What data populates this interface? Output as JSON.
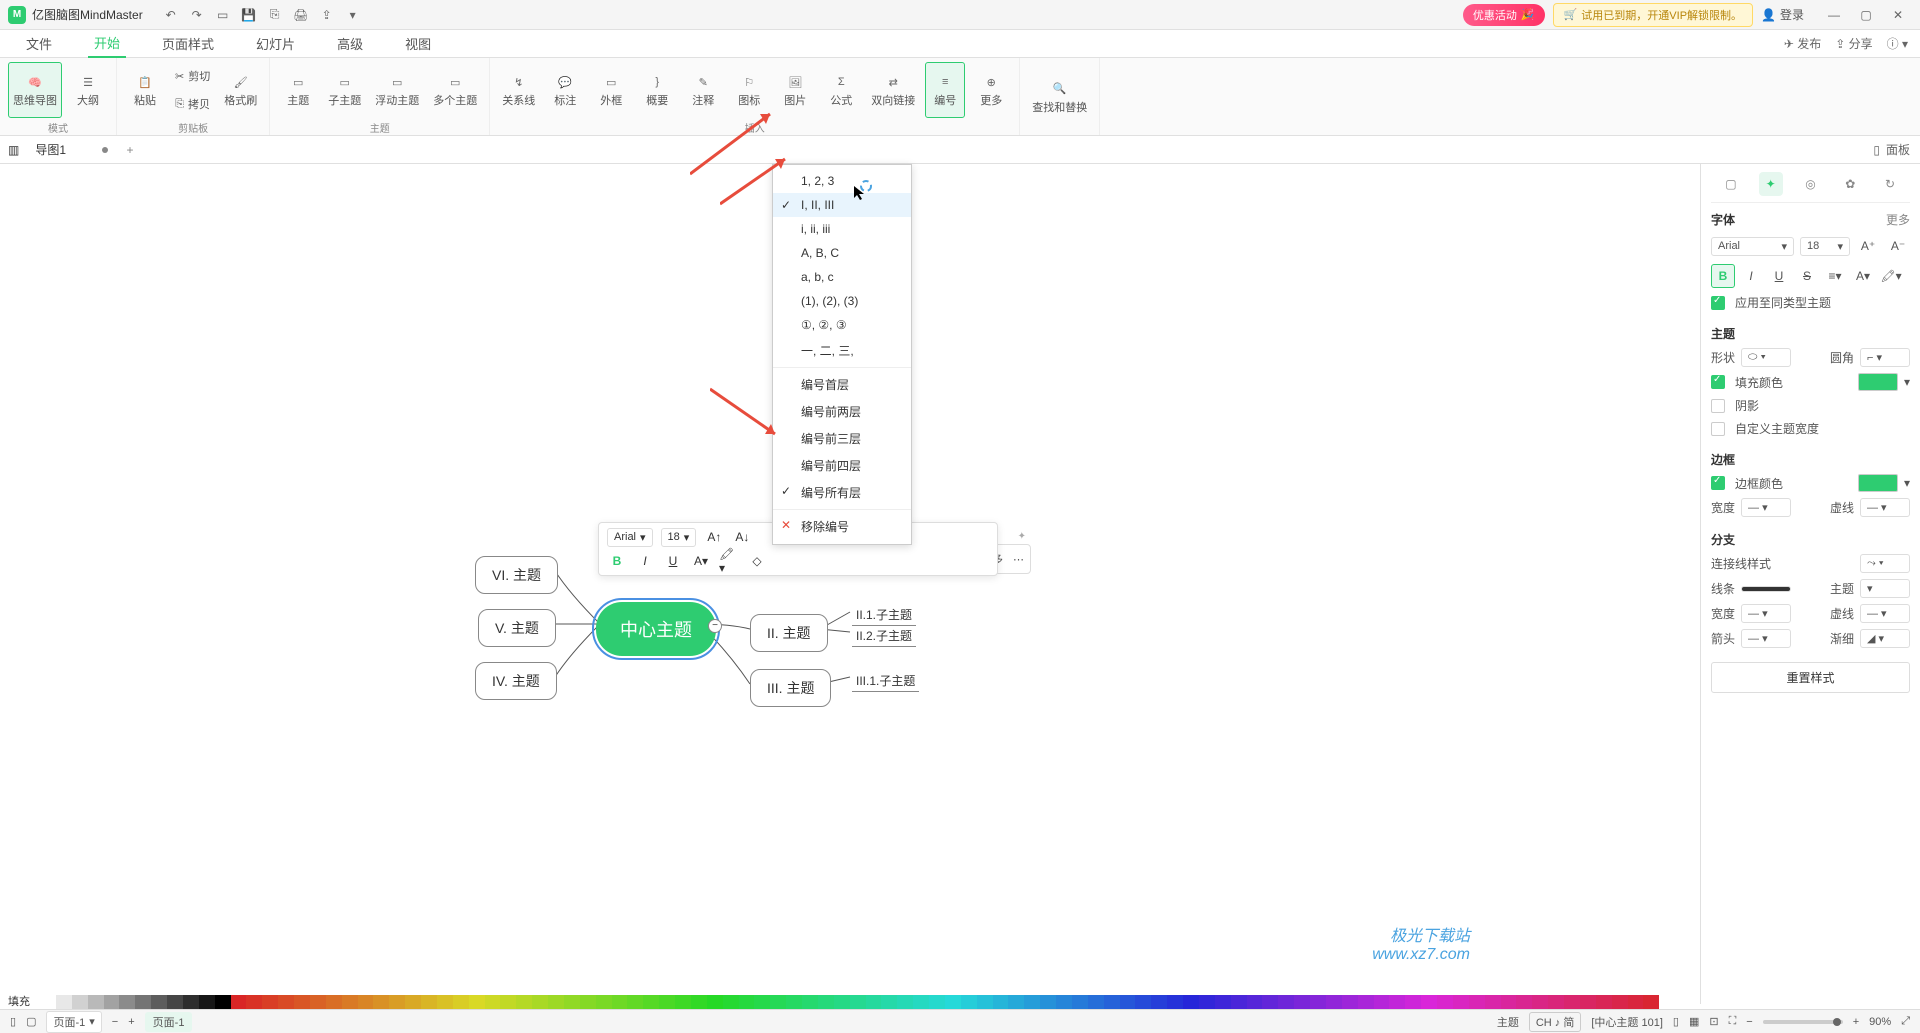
{
  "app": {
    "title": "亿图脑图MindMaster"
  },
  "titlebar": {
    "promo_red": "优惠活动",
    "promo_yellow": "试用已到期，开通VIP解锁限制。",
    "login": "登录"
  },
  "menu": {
    "items": [
      "文件",
      "开始",
      "页面样式",
      "幻灯片",
      "高级",
      "视图"
    ],
    "active_index": 1,
    "right": {
      "publish": "发布",
      "share": "分享"
    }
  },
  "ribbon": {
    "mode": {
      "mindmap": "思维导图",
      "outline": "大纲",
      "group": "模式"
    },
    "clipboard": {
      "paste": "粘贴",
      "cut": "剪切",
      "copy": "拷贝",
      "format_painter": "格式刷",
      "group": "剪贴板"
    },
    "topic": {
      "topic": "主题",
      "subtopic": "子主题",
      "floating": "浮动主题",
      "multi": "多个主题",
      "group": "主题"
    },
    "insert": {
      "relation": "关系线",
      "callout": "标注",
      "boundary": "外框",
      "summary": "概要",
      "comment": "注释",
      "icon": "图标",
      "image": "图片",
      "formula": "公式",
      "link": "双向链接",
      "numbering": "编号",
      "more": "更多",
      "group": "插入"
    },
    "find": {
      "label": "查找和替换"
    }
  },
  "doctab": {
    "name": "导图1",
    "panel_toggle": "面板"
  },
  "dropdown": {
    "items": [
      {
        "label": "1, 2, 3"
      },
      {
        "label": "I, II, III",
        "checked": true,
        "hover": true
      },
      {
        "label": "i, ii, iii"
      },
      {
        "label": "A, B, C"
      },
      {
        "label": "a, b, c"
      },
      {
        "label": "(1), (2), (3)"
      },
      {
        "label": "①, ②, ③"
      },
      {
        "label": "一, 二, 三,"
      }
    ],
    "levels": [
      {
        "label": "编号首层"
      },
      {
        "label": "编号前两层"
      },
      {
        "label": "编号前三层"
      },
      {
        "label": "编号前四层"
      },
      {
        "label": "编号所有层",
        "checked": true
      }
    ],
    "remove": "移除编号"
  },
  "float_toolbar": {
    "font": "Arial",
    "size": "18",
    "extra": {
      "connector": "连接线",
      "more": "更多"
    }
  },
  "mindmap": {
    "central": "中心主题",
    "left": [
      "VI. 主题",
      "V. 主题",
      "IV. 主题"
    ],
    "right": [
      "II. 主题",
      "III. 主题"
    ],
    "sub_right_1": [
      "II.1.子主题",
      "II.2.子主题"
    ],
    "sub_right_2": [
      "III.1.子主题"
    ]
  },
  "right_panel": {
    "font": {
      "title": "字体",
      "more": "更多",
      "family": "Arial",
      "size": "18",
      "apply_same": "应用至同类型主题"
    },
    "topic": {
      "title": "主题",
      "shape": "形状",
      "corner": "圆角",
      "fill": "填充颜色",
      "shadow": "阴影",
      "custom_width": "自定义主题宽度"
    },
    "border": {
      "title": "边框",
      "color": "边框颜色",
      "width": "宽度",
      "dash": "虚线"
    },
    "branch": {
      "title": "分支",
      "conn_style": "连接线样式",
      "line": "线条",
      "topic": "主题",
      "width": "宽度",
      "dash": "虚线",
      "arrow": "箭头",
      "taper": "渐细"
    },
    "reset": "重置样式"
  },
  "colorstrip_label": {
    "fill": "填充",
    "theme": "主题",
    "ime": "CH ♪ 简"
  },
  "status": {
    "page_label": "页面-1",
    "selection": "[中心主题 101]",
    "zoom": "90%"
  },
  "watermark": "极光下载站\nwww.xz7.com"
}
